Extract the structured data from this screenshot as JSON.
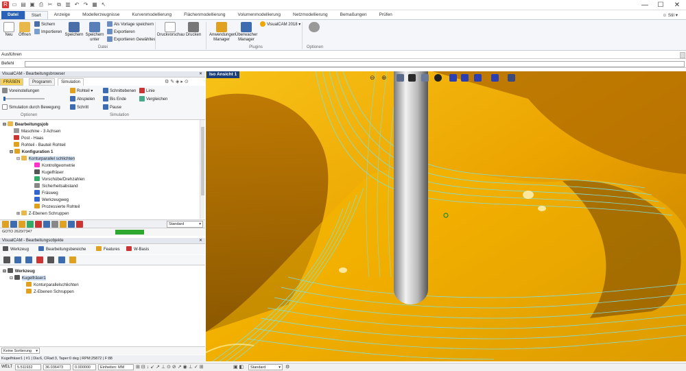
{
  "ribbon_tabs": [
    "Datei",
    "Start",
    "Anzeige",
    "Modellerzeugnisse",
    "Kurvenmodellierung",
    "Flächenmodellierung",
    "Volumenmodellierung",
    "Netzmodellierung",
    "Bemaßungen",
    "Prüfen"
  ],
  "user": "Stil",
  "ribbon": {
    "new": "Neu",
    "open": "Öffnen",
    "save": "Sichern",
    "import": "Importieren",
    "save_btn": "Speichern",
    "save_as": "Speichern unter",
    "save_template": "Als Vorlage speichern",
    "export": "Exportieren",
    "export_selected": "Exportieren Gewähltes",
    "print_preview": "Druckvorschau",
    "print": "Drucken",
    "app_manager": "Anwendungen Manager",
    "plugin_manager": "Überwacher Manager",
    "visualcam": "VisualCAM 2018",
    "group_datei": "Datei",
    "group_plugins": "Plugins",
    "group_optionen": "Optionen"
  },
  "command": {
    "history_label": "Ausführen",
    "command_label": "Befehl"
  },
  "browser": {
    "title": "VisualCAM - Bearbeitungsbrowser",
    "tabs": [
      "FRÄSEN",
      "Programm",
      "Simulation"
    ],
    "sim": {
      "preset": "Voreinstellungen",
      "simulate_by_move": "Simulation durch Bewegung",
      "stock": "Rohteil",
      "play": "Abspielen",
      "step": "Schritt",
      "slice_levels": "Schnittebenen",
      "to_end": "Bis Ende",
      "pause": "Pause",
      "lines": "Linie",
      "compare": "Vergleichen",
      "group_optionen": "Optionen",
      "group_simulation": "Simulation"
    },
    "tree": [
      "Bearbeitungsjob",
      "Maschine - 3 Achsen",
      "Post - Haas",
      "Rohteil - Bauteil Rohteil",
      "Konfiguration 1",
      "Konturparallel schlichten",
      "Kontrollgeometrie",
      "Kugelfräser",
      "Vorschübe/Drehzahlen",
      "Sicherheitsabstand",
      "Fräsweg",
      "Werkzeugweg",
      "Prozessierte Rohteil",
      "Z-Ebenen Schruppen"
    ],
    "standard": "Standard",
    "goto": "GOTO 2620/7347"
  },
  "objects": {
    "title": "VisualCAM - Bearbeitungsobjekte",
    "tabs": [
      "Werkzeug",
      "Bearbeitungsbereiche",
      "Features",
      "W-Basis"
    ],
    "tree": [
      "Werkzeug",
      "Kugelfräser1",
      "Konturparallelschlichten",
      "Z-Ebenen Schruppen"
    ],
    "sort": "Keine Sortierung"
  },
  "viewport": {
    "title": "Iso Ansicht 1"
  },
  "status": {
    "tool_info": "Kugelfräser1 | #1 | Dia:6, CRad:3, Taper:0 deg | RPM:25872 | F:88",
    "mode": "WELT",
    "x": "5.511932",
    "y": "36.036473",
    "z": "0.000000",
    "units": "Einheiten: MM",
    "standard": "Standard"
  },
  "colors": {
    "accent": "#2a62b8",
    "model": "#f0a800",
    "toolpath": "#5ad4d0"
  }
}
